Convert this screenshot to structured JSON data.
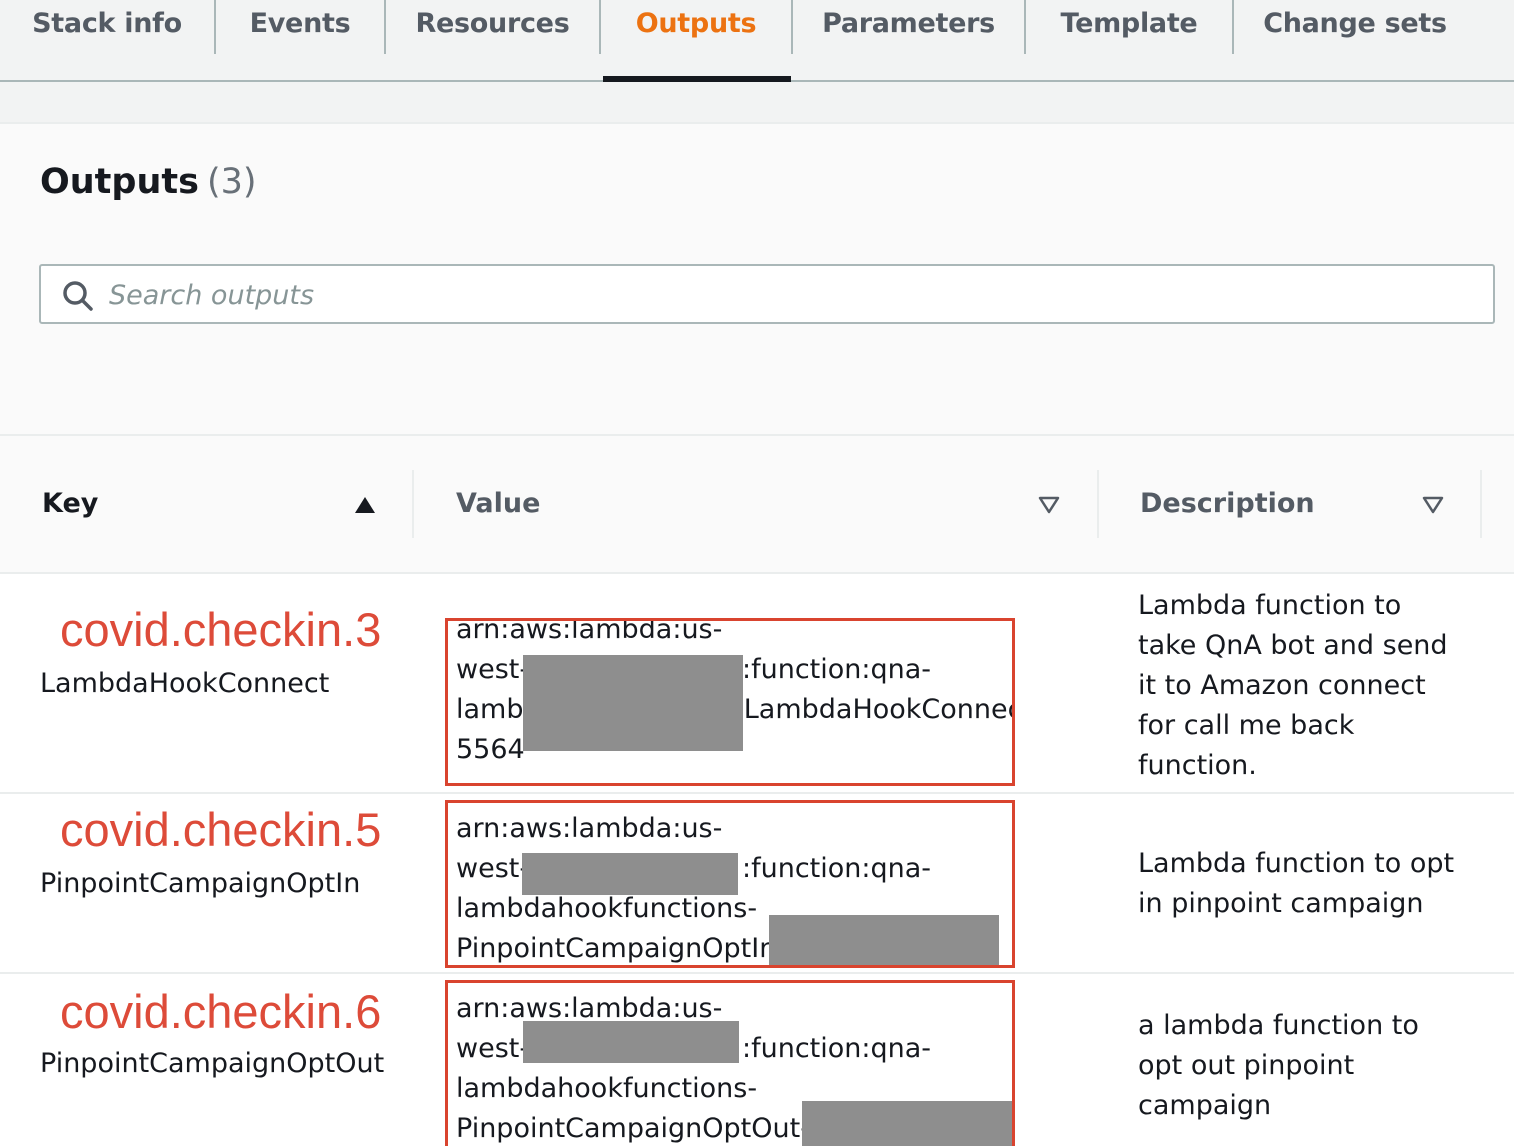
{
  "tabs": [
    {
      "label": "Stack info",
      "active": false
    },
    {
      "label": "Events",
      "active": false
    },
    {
      "label": "Resources",
      "active": false
    },
    {
      "label": "Outputs",
      "active": true
    },
    {
      "label": "Parameters",
      "active": false
    },
    {
      "label": "Template",
      "active": false
    },
    {
      "label": "Change sets",
      "active": false
    }
  ],
  "panel": {
    "title": "Outputs",
    "count": "(3)"
  },
  "search": {
    "placeholder": "Search outputs"
  },
  "table": {
    "columns": {
      "key": "Key",
      "value": "Value",
      "description": "Description"
    },
    "rows": [
      {
        "annotation": "covid.checkin.3",
        "key": "LambdaHookConnect",
        "value_lines": [
          "arn:aws:lambda:us-",
          "west-",
          ":function:qna-",
          "lamb",
          "-LambdaHookConnect-",
          "5564"
        ],
        "description_lines": [
          "Lambda function to",
          "take QnA bot and send",
          "it to Amazon connect",
          "for call me back",
          "function."
        ]
      },
      {
        "annotation": "covid.checkin.5",
        "key": "PinpointCampaignOptIn",
        "value_lines": [
          "arn:aws:lambda:us-",
          "west-",
          ":function:qna-",
          "lambdahookfunctions-",
          "PinpointCampaignOptIn-"
        ],
        "description_lines": [
          "Lambda function to opt",
          "in pinpoint campaign"
        ]
      },
      {
        "annotation": "covid.checkin.6",
        "key": "PinpointCampaignOptOut",
        "value_lines": [
          "arn:aws:lambda:us-",
          "west-",
          ":function:qna-",
          "lambdahookfunctions-",
          "PinpointCampaignOptOut-"
        ],
        "description_lines": [
          "a lambda function to",
          "opt out pinpoint",
          "campaign"
        ]
      }
    ]
  },
  "colors": {
    "active_tab": "#ec7211",
    "annotation": "#dd4b39",
    "redaction": "#8e8e8e"
  },
  "icons": {
    "search": "search-icon",
    "sort_asc": "sort-ascending-icon",
    "sort_none": "sort-descending-outline-icon"
  }
}
